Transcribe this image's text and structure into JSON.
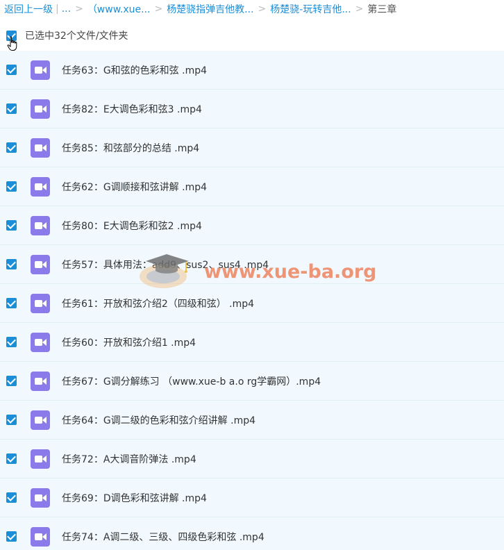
{
  "breadcrumb": {
    "back": "返回上一级",
    "ellipsis": "...",
    "items": [
      "（www.xue...",
      "杨楚骁指弹吉他教...",
      "杨楚骁-玩转吉他..."
    ],
    "current": "第三章"
  },
  "selection": {
    "label": "已选中32个文件/文件夹"
  },
  "files": [
    {
      "name": "任务63：G和弦的色彩和弦 .mp4"
    },
    {
      "name": "任务82：E大调色彩和弦3 .mp4"
    },
    {
      "name": "任务85：和弦部分的总结 .mp4"
    },
    {
      "name": "任务62：G调顺接和弦讲解 .mp4"
    },
    {
      "name": "任务80：E大调色彩和弦2 .mp4"
    },
    {
      "name": "任务57：具体用法：add9、sus2、sus4 .mp4"
    },
    {
      "name": "任务61：开放和弦介绍2（四级和弦） .mp4"
    },
    {
      "name": "任务60：开放和弦介绍1 .mp4"
    },
    {
      "name": "任务67：G调分解练习 （www.xue-b a.o rg学霸网）.mp4"
    },
    {
      "name": "任务64：G调二级的色彩和弦介绍讲解 .mp4"
    },
    {
      "name": "任务72：A大调音阶弹法 .mp4"
    },
    {
      "name": "任务69：D调色彩和弦讲解 .mp4"
    },
    {
      "name": "任务74：A调二级、三级、四级色彩和弦 .mp4"
    }
  ],
  "watermark": {
    "text": "www.xue-ba.org"
  },
  "icons": {
    "file": "video-file-icon",
    "cursor": "pointer-hand-icon",
    "watermark": "graduation-cap-icon"
  },
  "colors": {
    "accent": "#1a8fd8",
    "video_icon": "#8b7bea",
    "row_bg": "#f1f9fe"
  }
}
